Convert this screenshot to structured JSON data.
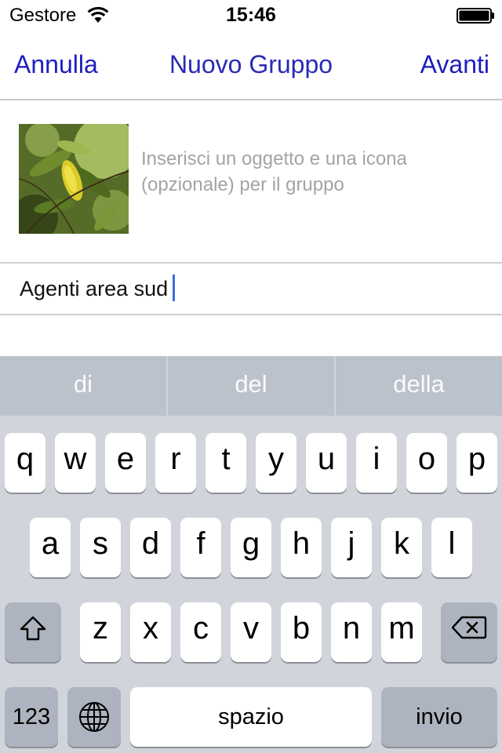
{
  "status_bar": {
    "carrier": "Gestore",
    "time": "15:46",
    "wifi_icon": "wifi-icon",
    "battery_icon": "battery-icon",
    "battery_level": 1.0
  },
  "nav": {
    "cancel_label": "Annulla",
    "title": "Nuovo Gruppo",
    "next_label": "Avanti",
    "accent_color": "#1e1ec0"
  },
  "group": {
    "hint": "Inserisci un oggetto e una icona (opzionale) per il gruppo",
    "subject_value": "Agenti area sud"
  },
  "keyboard": {
    "suggestions": [
      "di",
      "del",
      "della"
    ],
    "row1": [
      "q",
      "w",
      "e",
      "r",
      "t",
      "y",
      "u",
      "i",
      "o",
      "p"
    ],
    "row2": [
      "a",
      "s",
      "d",
      "f",
      "g",
      "h",
      "j",
      "k",
      "l"
    ],
    "row3": [
      "z",
      "x",
      "c",
      "v",
      "b",
      "n",
      "m"
    ],
    "numbers_label": "123",
    "space_label": "spazio",
    "return_label": "invio",
    "shift_icon": "shift-icon",
    "globe_icon": "globe-icon",
    "backspace_icon": "backspace-icon"
  }
}
